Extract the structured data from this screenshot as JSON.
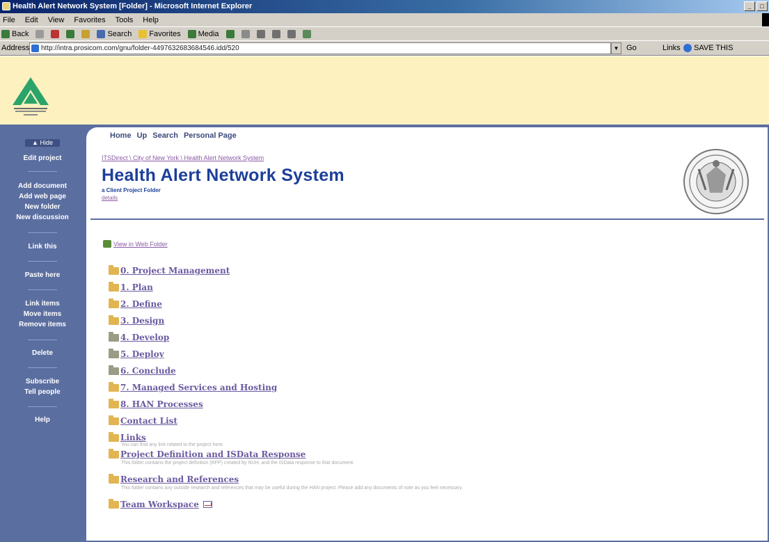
{
  "browser": {
    "title": "Health Alert Network System [Folder] - Microsoft Internet Explorer",
    "menu": [
      "File",
      "Edit",
      "View",
      "Favorites",
      "Tools",
      "Help"
    ],
    "toolbar": [
      "Back",
      "",
      "Search",
      "Favorites",
      "Media"
    ],
    "address_label": "Address",
    "address_value": "http://intra.prosicom.com/gnu/folder-4497632683684546.idd/520",
    "go": "Go",
    "links": "Links",
    "save_this": "SAVE THIS"
  },
  "topnav": [
    "Home",
    "Up",
    "Search",
    "Personal Page"
  ],
  "breadcrumb": "ITSDirect \\ City of New York \\ Health Alert Network System",
  "page": {
    "title": "Health Alert Network System",
    "subtitle": "a Client Project Folder",
    "details": "details"
  },
  "web_folder_link": "View in Web Folder",
  "sidebar": {
    "hide": "Hide",
    "items": [
      "Edit project",
      "Add document",
      "Add web page",
      "New folder",
      "New discussion",
      "Link this",
      "Paste here",
      "Link items",
      "Move items",
      "Remove items",
      "Delete",
      "Subscribe",
      "Tell people",
      "Help"
    ]
  },
  "folders": [
    {
      "name": "0. Project Management",
      "desc": ""
    },
    {
      "name": "1. Plan",
      "desc": ""
    },
    {
      "name": "2. Define",
      "desc": ""
    },
    {
      "name": "3. Design",
      "desc": ""
    },
    {
      "name": "4. Develop",
      "desc": ""
    },
    {
      "name": "5. Deploy",
      "desc": ""
    },
    {
      "name": "6. Conclude",
      "desc": ""
    },
    {
      "name": "7. Managed Services and Hosting",
      "desc": ""
    },
    {
      "name": "8. HAN Processes",
      "desc": ""
    },
    {
      "name": "Contact List",
      "desc": ""
    },
    {
      "name": "Links",
      "desc": "You can find any link related to the project here."
    },
    {
      "name": "Project Definition and ISData Response",
      "desc": "This folder contains the project definition (RFP) created by NUH, and the ISData response to that document."
    },
    {
      "name": "Research and References",
      "desc": "This folder contains any outside research and references that may be useful during the HAN project. Please add any documents of note as you feel necessary."
    },
    {
      "name": "Team Workspace",
      "desc": ""
    }
  ],
  "colors": {
    "sidebar": "#5b6ea0",
    "title_blue": "#1c3f9a",
    "link_purple": "#6b5aa0",
    "banner": "#fdf1bf"
  }
}
